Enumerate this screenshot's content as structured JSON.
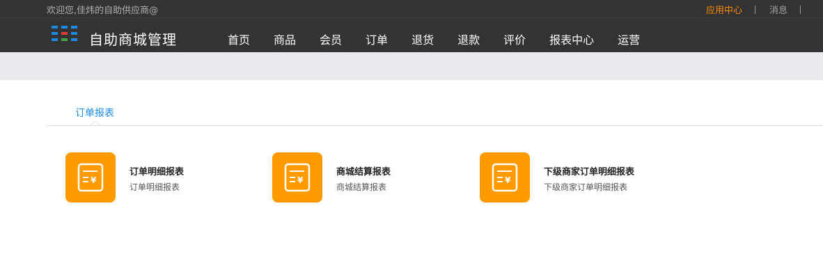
{
  "header": {
    "welcome": "欢迎您,佳炜的自助供应商@",
    "app_center": "应用中心",
    "messages": "消息",
    "brand": "自助商城管理"
  },
  "nav": {
    "items": [
      "首页",
      "商品",
      "会员",
      "订单",
      "退货",
      "退款",
      "评价",
      "报表中心",
      "运营"
    ]
  },
  "tabs": {
    "active": "订单报表"
  },
  "cards": [
    {
      "title": "订单明细报表",
      "desc": "订单明细报表",
      "icon": "receipt-icon"
    },
    {
      "title": "商城结算报表",
      "desc": "商城结算报表",
      "icon": "receipt-icon"
    },
    {
      "title": "下级商家订单明细报表",
      "desc": "下级商家订单明细报表",
      "icon": "receipt-icon"
    }
  ],
  "colors": {
    "topbar": "#333333",
    "accent_orange": "#ff9a00",
    "link_blue": "#1a8ce8",
    "app_center_orange": "#ff8a00"
  }
}
